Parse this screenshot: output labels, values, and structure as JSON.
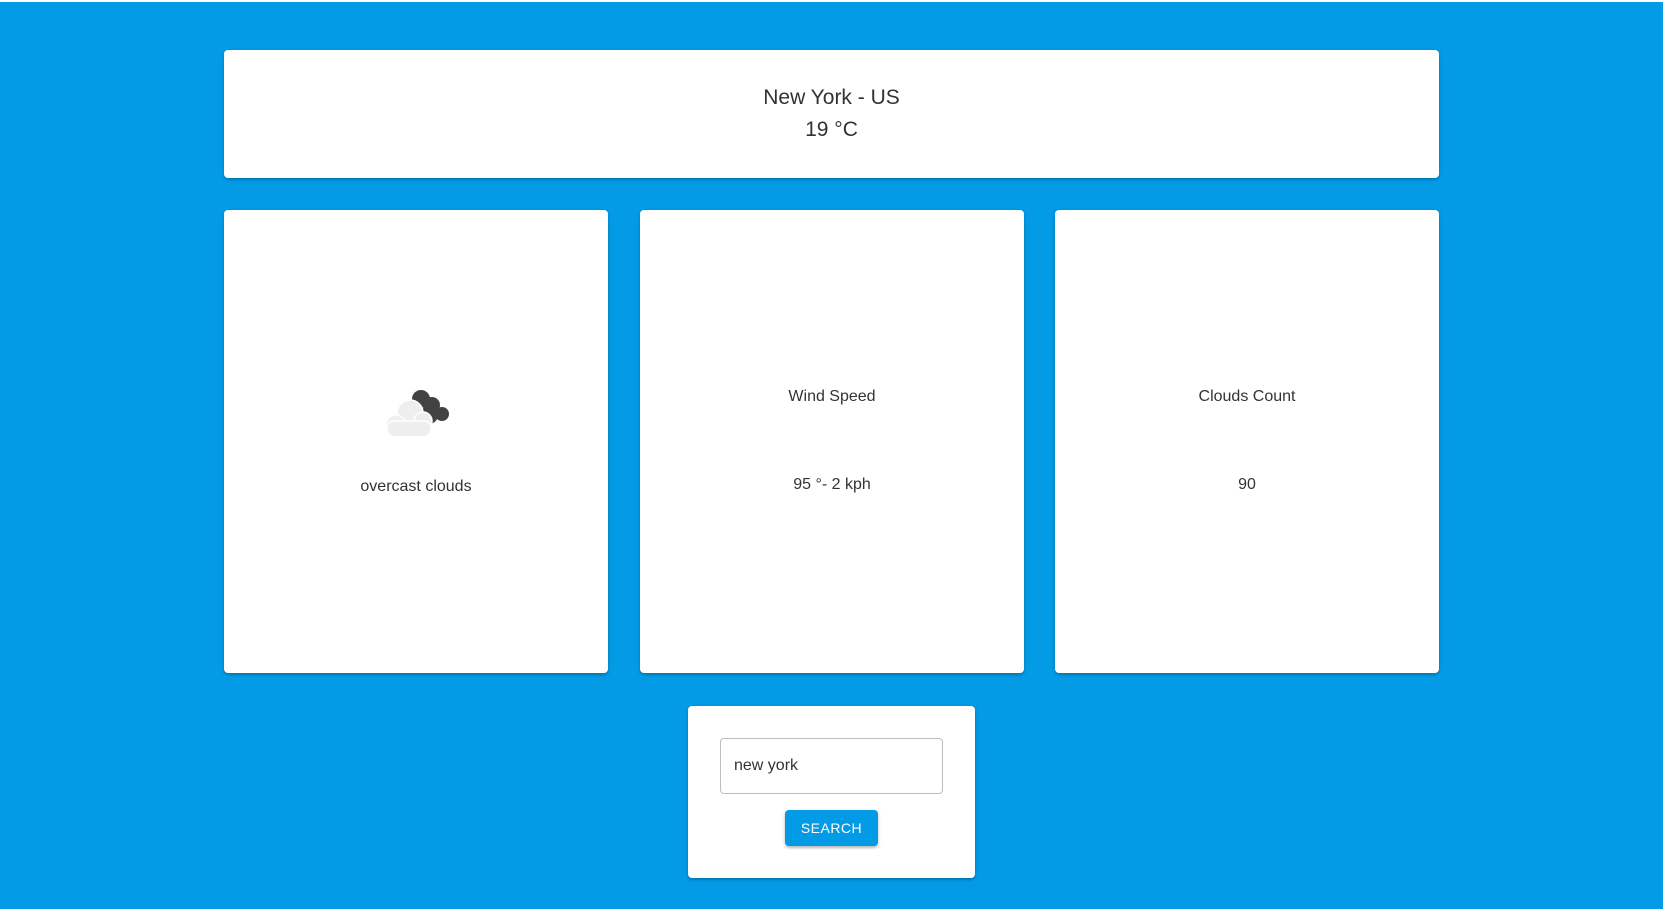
{
  "location": {
    "city": "New York - US",
    "temperature": "19 °C"
  },
  "condition": {
    "icon": "overcast-clouds-icon",
    "description": "overcast clouds"
  },
  "wind": {
    "label": "Wind Speed",
    "value": "95 °- 2 kph"
  },
  "clouds": {
    "label": "Clouds Count",
    "value": "90"
  },
  "search": {
    "value": "new york",
    "button_label": "SEARCH"
  },
  "colors": {
    "background": "#039be5",
    "card": "#ffffff",
    "button": "#039be5",
    "text": "#333333"
  }
}
